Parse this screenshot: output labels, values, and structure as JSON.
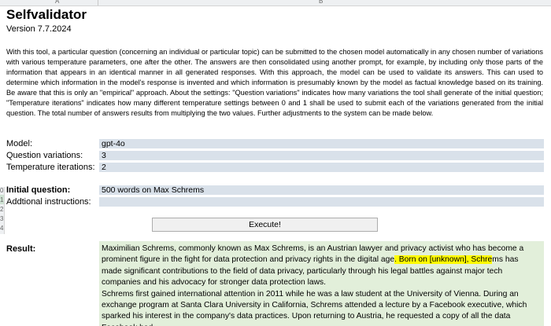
{
  "column_headers": [
    "A",
    "B"
  ],
  "row_headers": [
    "0",
    "1",
    "2",
    "3",
    "4"
  ],
  "title": "Selfvalidator",
  "version": "Version 7.7.2024",
  "description": "With this tool, a particular question (concerning an individual or particular topic) can be submitted to the chosen model automatically in any chosen number of variations with various temperature parameters, one after the other. The answers are then consolidated using another prompt, for example, by including only those parts of the information that appears in an identical manner in all generated responses. With this approach, the model can be used to validate its answers. This can used to determine which information in the model's response is invented and which information is presumably known by the model as factual knowledge based on its training. Be aware that this is only an \"empirical\" approach. About the settings: \"Question variations\" indicates how many variations the tool shall generate of the initial question; \"Temperature iterations\" indicates how many different temperature settings between 0 and 1 shall be used to submit each of the variations generated from the initial question. The total number of answers results from multiplying the two values. Further adjustments to the system can be made below.",
  "settings": {
    "model_label": "Model:",
    "model_value": "gpt-4o",
    "variations_label": "Question variations:",
    "variations_value": "3",
    "temperature_label": "Temperature iterations:",
    "temperature_value": "2"
  },
  "question": {
    "initial_label": "Initial question:",
    "initial_value": "500 words on Max Schrems",
    "instructions_label": "Addtional instructions:",
    "instructions_value": ""
  },
  "execute_label": "Execute!",
  "result": {
    "label": "Result:",
    "p1_before": "Maximilian Schrems, commonly known as Max Schrems, is an Austrian lawyer and privacy activist who has become a prominent figure in the fight for data protection and privacy rights in the digital age",
    "p1_highlight": ". Born on [unknown], Schre",
    "p1_after": "ms has made significant contributions to the field of data privacy, particularly through his legal battles against major tech companies and his advocacy for stronger data protection laws.",
    "p2": "Schrems first gained international attention in 2011 while he was a law student at the University of Vienna. During an exchange program at Santa Clara University in California, Schrems attended a lecture by a Facebook executive, which sparked his interest in the company's data practices. Upon returning to Austria, he requested a copy of all the data Facebook had"
  },
  "colors": {
    "field_bg": "#d9e1ea",
    "result_bg": "#e2efda",
    "highlight": "#fffb00"
  }
}
